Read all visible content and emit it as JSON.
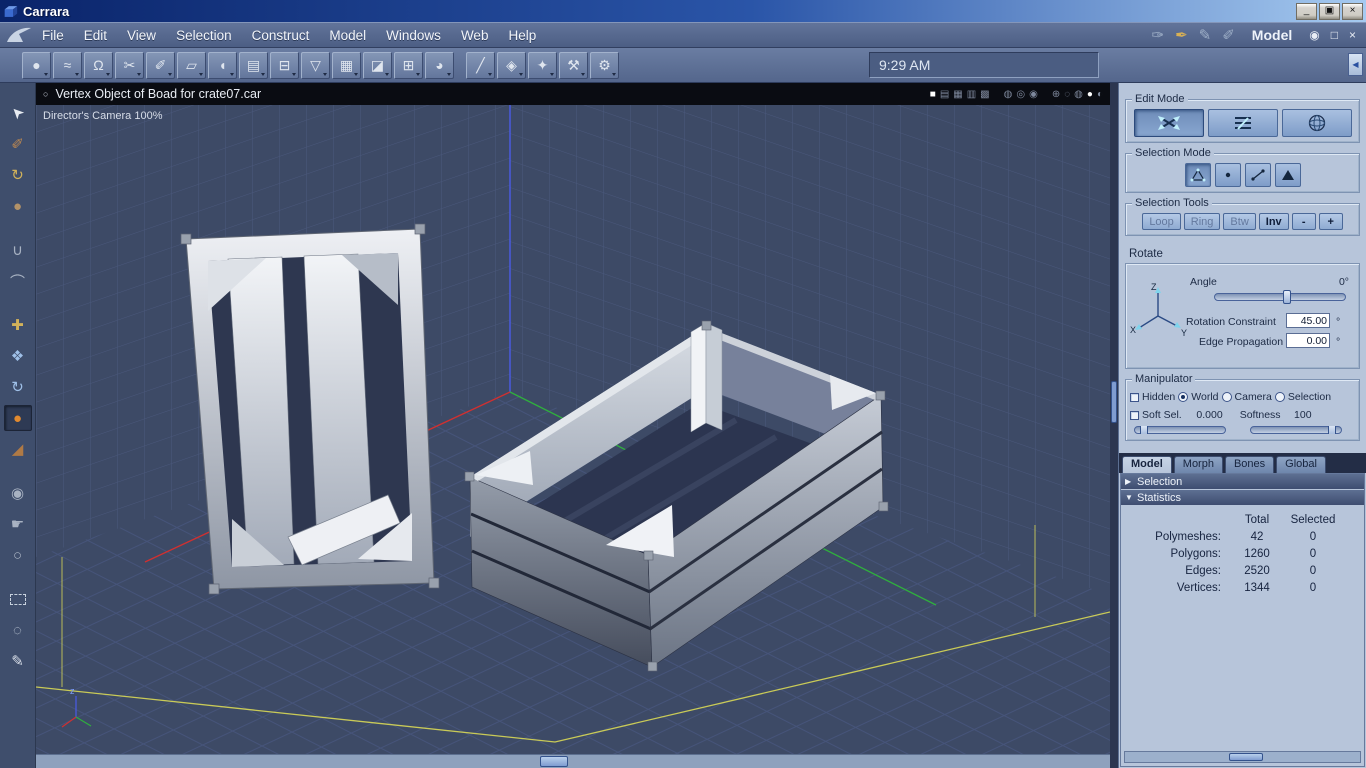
{
  "window": {
    "title": "Carrara",
    "minimize_glyph": "_",
    "restore_glyph": "▣",
    "close_glyph": "×"
  },
  "menubar": {
    "items": [
      "File",
      "Edit",
      "View",
      "Selection",
      "Construct",
      "Model",
      "Windows",
      "Web",
      "Help"
    ],
    "rooms": [
      {
        "name": "assemble-room",
        "glyph": "✑"
      },
      {
        "name": "model-room",
        "glyph": "✒"
      },
      {
        "name": "texture-room",
        "glyph": "✎"
      },
      {
        "name": "render-room",
        "glyph": "✐"
      }
    ],
    "room_label": "Model",
    "eye_glyph": "◉",
    "panel_restore_glyph": "□",
    "panel_close_glyph": "×"
  },
  "toolbar": {
    "time": "9:29 AM",
    "collapse_glyph": "◀",
    "icons": [
      {
        "name": "sphere-primitive-tool",
        "glyph": "●"
      },
      {
        "name": "spline-tool",
        "glyph": "≈"
      },
      {
        "name": "lathe-tool",
        "glyph": "Ω"
      },
      {
        "name": "scissors-tool",
        "glyph": "✂"
      },
      {
        "name": "knife-tool",
        "glyph": "✐"
      },
      {
        "name": "marquee-tool",
        "glyph": "▱"
      },
      {
        "name": "dome-tool",
        "glyph": "◖"
      },
      {
        "name": "stamp-tool",
        "glyph": "▤"
      },
      {
        "name": "extrude-tool",
        "glyph": "⊟"
      },
      {
        "name": "funnel-tool",
        "glyph": "▽"
      },
      {
        "name": "dither-tool",
        "glyph": "▦"
      },
      {
        "name": "box-tool",
        "glyph": "◪"
      },
      {
        "name": "clipboard-tool",
        "glyph": "⊞"
      },
      {
        "name": "orbit-tool",
        "glyph": "◕"
      },
      {
        "name": "slash-tool",
        "glyph": "╱"
      },
      {
        "name": "bend-tool",
        "glyph": "◈"
      },
      {
        "name": "sparkle-tool",
        "glyph": "✦"
      },
      {
        "name": "hammer-tool",
        "glyph": "⚒"
      },
      {
        "name": "gear-tool",
        "glyph": "⚙"
      }
    ]
  },
  "sidebar": {
    "icons": [
      {
        "name": "select-arrow",
        "glyph": "➤"
      },
      {
        "name": "dart-tool",
        "glyph": "✐"
      },
      {
        "name": "rotate-tool",
        "glyph": "↻"
      },
      {
        "name": "sphere-tool",
        "glyph": "●"
      },
      {
        "name": "magnet-tool",
        "glyph": "∪"
      },
      {
        "name": "arc-tool",
        "glyph": "⌒"
      },
      {
        "name": "translate-tool",
        "glyph": "✚"
      },
      {
        "name": "move-tool",
        "glyph": "❖"
      },
      {
        "name": "rotate-manip-tool",
        "glyph": "↻"
      },
      {
        "name": "hotpoint-tool",
        "glyph": "●"
      },
      {
        "name": "ramp-tool",
        "glyph": "◢"
      },
      {
        "name": "camera-tool",
        "glyph": "◉"
      },
      {
        "name": "pan-hand-tool",
        "glyph": "☛"
      },
      {
        "name": "zoom-tool",
        "glyph": "○"
      },
      {
        "name": "marquee-select-tool",
        "glyph": ""
      },
      {
        "name": "lasso-tool",
        "glyph": "◌"
      },
      {
        "name": "pencil-tool",
        "glyph": "✎"
      }
    ]
  },
  "viewport": {
    "status_glyph": "○",
    "header_title": "Vertex Object of Boad for crate07.car",
    "camera_label": "Director's Camera 100%",
    "tripod_label": "z",
    "header_icons": [
      {
        "name": "layout-single",
        "glyph": "■"
      },
      {
        "name": "layout-two",
        "glyph": "▤"
      },
      {
        "name": "layout-four",
        "glyph": "▦"
      },
      {
        "name": "layout-columns",
        "glyph": "▥"
      },
      {
        "name": "layout-grid",
        "glyph": "▩"
      },
      {
        "name": "globe-wire-1",
        "glyph": "◍"
      },
      {
        "name": "globe-wire-2",
        "glyph": "◎"
      },
      {
        "name": "globe-wire-3",
        "glyph": "◉"
      },
      {
        "name": "axes-display",
        "glyph": "⊕"
      },
      {
        "name": "dotted-sphere",
        "glyph": "◌"
      },
      {
        "name": "wire-sphere",
        "glyph": "◍"
      },
      {
        "name": "shaded-sphere",
        "glyph": "●"
      },
      {
        "name": "textured-sphere",
        "glyph": "◐"
      }
    ]
  },
  "panel": {
    "edit_mode_label": "Edit Mode",
    "selection_mode_label": "Selection Mode",
    "selection_tools_label": "Selection Tools",
    "selection_tools": [
      "Loop",
      "Ring",
      "Btw",
      "Inv",
      "-",
      "+"
    ],
    "rotate": {
      "label": "Rotate",
      "angle_label": "Angle",
      "angle_value": "0°",
      "axis": {
        "x": "X",
        "y": "Y",
        "z": "Z"
      },
      "rotation_constraint_label": "Rotation Constraint",
      "rotation_constraint_value": "45.00",
      "edge_propagation_label": "Edge Propagation",
      "edge_propagation_value": "0.00",
      "deg": "°"
    },
    "manipulator": {
      "label": "Manipulator",
      "hidden_label": "Hidden",
      "options": [
        "World",
        "Camera",
        "Selection"
      ],
      "selected_option": "World",
      "soft_sel_label": "Soft Sel.",
      "soft_sel_value": "0.000",
      "softness_label": "Softness",
      "softness_value": "100"
    },
    "tabs": [
      "Model",
      "Morph",
      "Bones",
      "Global"
    ],
    "active_tab": "Model",
    "sections": {
      "selection": "Selection",
      "statistics": "Statistics",
      "collapsed_glyph": "▶",
      "expanded_glyph": "▼"
    },
    "statistics": {
      "columns": [
        "Total",
        "Selected"
      ],
      "rows": [
        {
          "label": "Polymeshes:",
          "total": "42",
          "selected": "0"
        },
        {
          "label": "Polygons:",
          "total": "1260",
          "selected": "0"
        },
        {
          "label": "Edges:",
          "total": "2520",
          "selected": "0"
        },
        {
          "label": "Vertices:",
          "total": "1344",
          "selected": "0"
        }
      ]
    }
  },
  "colors": {
    "titlebar_left": "#0a246a",
    "titlebar_right": "#a6caf0",
    "viewport_bg": "#3d4a66",
    "panel_bg": "#b7c5da",
    "accent_blue": "#2a50a0",
    "selection_cyan": "#9fe8f8"
  }
}
